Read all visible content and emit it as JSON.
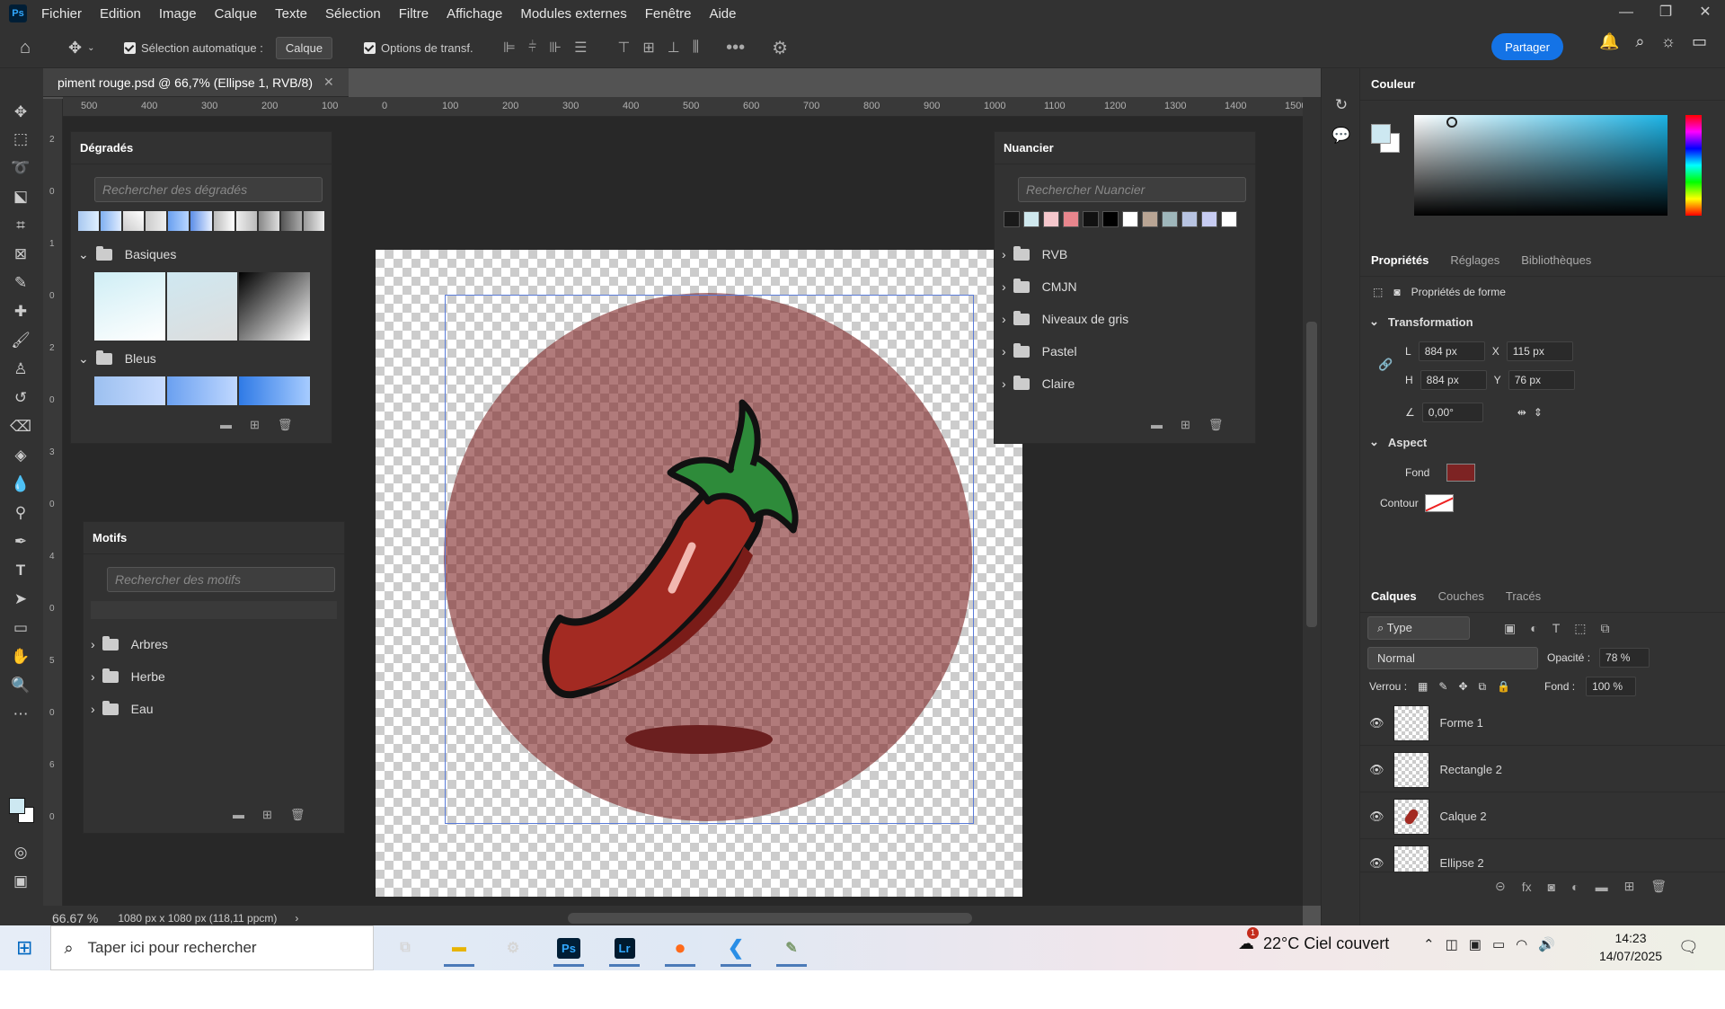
{
  "menu": {
    "items": [
      "Fichier",
      "Edition",
      "Image",
      "Calque",
      "Texte",
      "Sélection",
      "Filtre",
      "Affichage",
      "Modules externes",
      "Fenêtre",
      "Aide"
    ],
    "app_icon": "Ps"
  },
  "options": {
    "auto_select_label": "Sélection automatique :",
    "auto_select_value": "Calque",
    "transform_label": "Options de transf.",
    "share": "Partager"
  },
  "document": {
    "tab_title": "piment rouge.psd @ 66,7% (Ellipse 1, RVB/8)",
    "zoom": "66.67 %",
    "info": "1080 px x 1080 px (118,11 ppcm)"
  },
  "ruler": {
    "h": [
      "500",
      "400",
      "300",
      "200",
      "100",
      "0",
      "100",
      "200",
      "300",
      "400",
      "500",
      "600",
      "700",
      "800",
      "900",
      "1000",
      "1100",
      "1200",
      "1300",
      "1400",
      "1500"
    ],
    "v": [
      "2",
      "0",
      "1",
      "0",
      "2",
      "0",
      "3",
      "0",
      "4",
      "0",
      "5",
      "0",
      "6",
      "0"
    ]
  },
  "gradients": {
    "title": "Dégradés",
    "search": "Rechercher des dégradés",
    "groups": [
      "Basiques",
      "Bleus"
    ]
  },
  "patterns": {
    "title": "Motifs",
    "search": "Rechercher des motifs",
    "groups": [
      "Arbres",
      "Herbe",
      "Eau"
    ]
  },
  "swatches": {
    "title": "Nuancier",
    "search": "Rechercher Nuancier",
    "groups": [
      "RVB",
      "CMJN",
      "Niveaux de gris",
      "Pastel",
      "Claire"
    ],
    "colors": [
      "#1a1a1a",
      "#cfe8ee",
      "#f5c7cc",
      "#e8868d",
      "#111111",
      "#000000",
      "#ffffff",
      "#b9a594",
      "#9fb7bb",
      "#b8c4e2",
      "#c7ccf2",
      "#ffffff"
    ]
  },
  "color": {
    "title": "Couleur",
    "fg": "#cde8f1",
    "bg": "#ffffff"
  },
  "properties": {
    "tabs": [
      "Propriétés",
      "Réglages",
      "Bibliothèques"
    ],
    "shape_label": "Propriétés de forme",
    "transform": "Transformation",
    "w_label": "L",
    "w": "884 px",
    "x_label": "X",
    "x": "115 px",
    "h_label": "H",
    "h": "884 px",
    "y_label": "Y",
    "y": "76 px",
    "angle": "0,00°",
    "aspect": "Aspect",
    "fill_label": "Fond",
    "fill_color": "#7d2323",
    "stroke_label": "Contour"
  },
  "layers": {
    "tabs": [
      "Calques",
      "Couches",
      "Tracés"
    ],
    "filter": "Type",
    "blend": "Normal",
    "opacity_label": "Opacité :",
    "opacity": "78 %",
    "lock_label": "Verrou :",
    "fill_label": "Fond :",
    "fill": "100 %",
    "items": [
      "Forme 1",
      "Rectangle 2",
      "Calque 2",
      "Ellipse 2"
    ]
  },
  "taskbar": {
    "search": "Taper ici pour rechercher",
    "weather": "22°C Ciel couvert",
    "weather_badge": "1",
    "time": "14:23",
    "date": "14/07/2025",
    "apps": [
      "Ps",
      "Lr"
    ]
  }
}
